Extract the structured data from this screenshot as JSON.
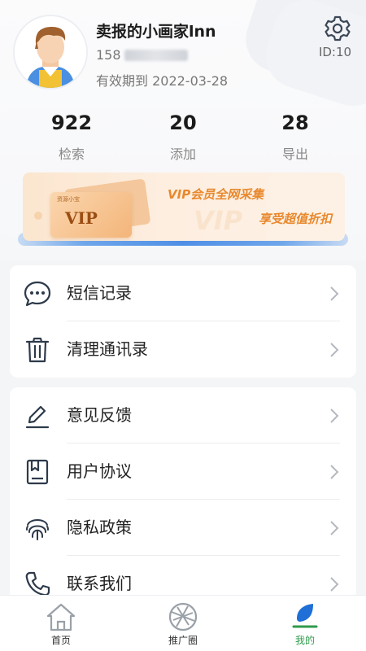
{
  "profile": {
    "username": "卖报的小画家lnn",
    "phone_prefix": "158",
    "expiry": "有效期到 2022-03-28",
    "id_label": "ID:10"
  },
  "stats": [
    {
      "value": "922",
      "label": "检索"
    },
    {
      "value": "20",
      "label": "添加"
    },
    {
      "value": "28",
      "label": "导出"
    }
  ],
  "vip_banner": {
    "ticket_small": "资源小宝",
    "ticket_badge": "VIP",
    "line1": "VIP会员全网采集",
    "line2": "享受超值折扣",
    "ghost": "VIP"
  },
  "menu_group1": [
    {
      "label": "短信记录",
      "icon": "message-icon"
    },
    {
      "label": "清理通讯录",
      "icon": "trash-icon"
    }
  ],
  "menu_group2": [
    {
      "label": "意见反馈",
      "icon": "edit-icon"
    },
    {
      "label": "用户协议",
      "icon": "agreement-icon"
    },
    {
      "label": "隐私政策",
      "icon": "fingerprint-icon"
    },
    {
      "label": "联系我们",
      "icon": "phone-icon"
    }
  ],
  "tabbar": [
    {
      "label": "首页",
      "icon": "home-icon"
    },
    {
      "label": "推广圈",
      "icon": "aperture-icon"
    },
    {
      "label": "我的",
      "icon": "profile-icon",
      "active": true
    }
  ],
  "colors": {
    "accent_green": "#2f9a4b",
    "accent_blue": "#1f6fd6",
    "vip_orange": "#e8892e",
    "icon_dark": "#2d3a4a"
  }
}
